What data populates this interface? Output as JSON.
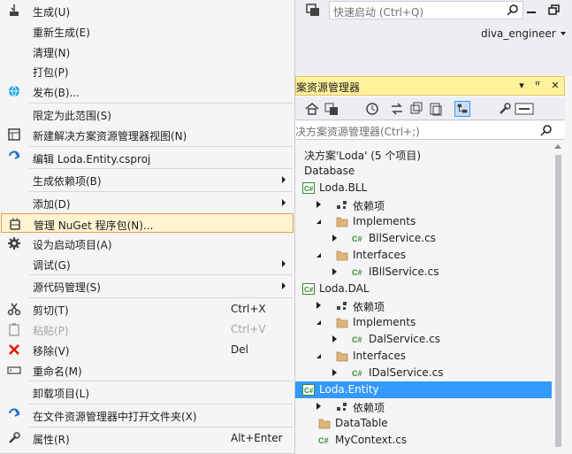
{
  "topbar": {
    "quick_launch_placeholder": "快速启动 (Ctrl+Q)",
    "user_name": "diva_engineer"
  },
  "explorer": {
    "title": "案资源管理器",
    "search_placeholder": "决方案资源管理器(Ctrl+;)",
    "tree": [
      {
        "label": "决方案'Loda' (5 个项目)",
        "indent": 0,
        "exp": "none",
        "icon": "none"
      },
      {
        "label": "Database",
        "indent": 0,
        "exp": "none",
        "icon": "none"
      },
      {
        "label": "Loda.BLL",
        "indent": 0,
        "exp": "none",
        "icon": "csproj"
      },
      {
        "label": "依赖项",
        "indent": 1,
        "exp": "closed",
        "icon": "deps"
      },
      {
        "label": "Implements",
        "indent": 1,
        "exp": "open",
        "icon": "folder"
      },
      {
        "label": "BllService.cs",
        "indent": 2,
        "exp": "closed",
        "icon": "cs"
      },
      {
        "label": "Interfaces",
        "indent": 1,
        "exp": "open",
        "icon": "folder"
      },
      {
        "label": "IBllService.cs",
        "indent": 2,
        "exp": "closed",
        "icon": "cs"
      },
      {
        "label": "Loda.DAL",
        "indent": 0,
        "exp": "none",
        "icon": "csproj"
      },
      {
        "label": "依赖项",
        "indent": 1,
        "exp": "closed",
        "icon": "deps"
      },
      {
        "label": "Implements",
        "indent": 1,
        "exp": "open",
        "icon": "folder"
      },
      {
        "label": "DalService.cs",
        "indent": 2,
        "exp": "closed",
        "icon": "cs"
      },
      {
        "label": "Interfaces",
        "indent": 1,
        "exp": "open",
        "icon": "folder"
      },
      {
        "label": "IDalService.cs",
        "indent": 2,
        "exp": "closed",
        "icon": "cs"
      },
      {
        "label": "Loda.Entity",
        "indent": 0,
        "exp": "none",
        "icon": "csproj",
        "selected": true
      },
      {
        "label": "依赖项",
        "indent": 1,
        "exp": "closed",
        "icon": "deps"
      },
      {
        "label": "DataTable",
        "indent": 1,
        "exp": "none",
        "icon": "folder"
      },
      {
        "label": "MyContext.cs",
        "indent": 1,
        "exp": "none",
        "icon": "cs"
      }
    ]
  },
  "menu": {
    "items": [
      {
        "label": "生成(U)",
        "icon": "build-icon"
      },
      {
        "label": "重新生成(E)"
      },
      {
        "label": "清理(N)"
      },
      {
        "label": "打包(P)"
      },
      {
        "label": "发布(B)...",
        "icon": "globe-icon"
      },
      {
        "sep": true
      },
      {
        "label": "限定为此范围(S)"
      },
      {
        "label": "新建解决方案资源管理器视图(N)",
        "icon": "new-view-icon"
      },
      {
        "sep": true
      },
      {
        "label": "编辑 Loda.Entity.csproj",
        "icon": "edit-icon"
      },
      {
        "sep": true
      },
      {
        "label": "生成依赖项(B)",
        "submenu": true
      },
      {
        "sep": true
      },
      {
        "label": "添加(D)",
        "submenu": true
      },
      {
        "label": "管理 NuGet 程序包(N)...",
        "icon": "nuget-icon",
        "highlight": true
      },
      {
        "label": "设为启动项目(A)",
        "icon": "gear-icon"
      },
      {
        "label": "调试(G)",
        "submenu": true
      },
      {
        "sep": true
      },
      {
        "label": "源代码管理(S)",
        "submenu": true
      },
      {
        "sep": true
      },
      {
        "label": "剪切(T)",
        "shortcut": "Ctrl+X",
        "icon": "scissors-icon"
      },
      {
        "label": "粘贴(P)",
        "shortcut": "Ctrl+V",
        "icon": "paste-icon",
        "disabled": true
      },
      {
        "label": "移除(V)",
        "shortcut": "Del",
        "icon": "remove-icon"
      },
      {
        "label": "重命名(M)",
        "icon": "rename-icon"
      },
      {
        "sep": true
      },
      {
        "label": "卸载项目(L)"
      },
      {
        "sep": true
      },
      {
        "label": "在文件资源管理器中打开文件夹(X)",
        "icon": "refresh-icon"
      },
      {
        "sep": true
      },
      {
        "label": "属性(R)",
        "shortcut": "Alt+Enter",
        "icon": "wrench-icon"
      }
    ]
  }
}
